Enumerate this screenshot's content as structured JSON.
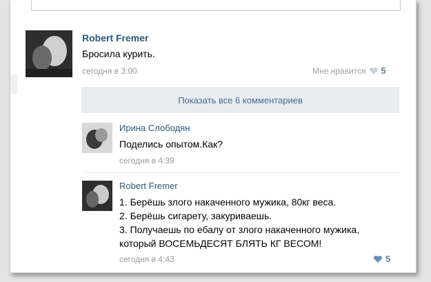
{
  "post": {
    "author": "Robert Fremer",
    "text": "Бросила курить.",
    "time": "сегодня в 3:00",
    "like_label": "Мне нравится",
    "like_count": "5"
  },
  "show_all_comments": "Показать все 6 комментариев",
  "comments": [
    {
      "author": "Ирина Слободян",
      "text": "Поделись опытом.Как?",
      "time": "сегодня в 4:39"
    },
    {
      "author": "Robert Fremer",
      "lines": [
        "1. Берёшь злого накаченного мужика, 80кг веса.",
        "2. Берёшь сигарету, закуриваешь.",
        "3. Получаешь по ебалу от злого накаченного мужика,",
        "который ВОСЕМЬДЕСЯТ БЛЯТЬ КГ ВЕСОМ!"
      ],
      "time": "сегодня в 4:43",
      "like_count": "5"
    }
  ],
  "colors": {
    "link": "#2b587a",
    "muted": "#999999",
    "show_all_bg": "#e9edf1"
  }
}
